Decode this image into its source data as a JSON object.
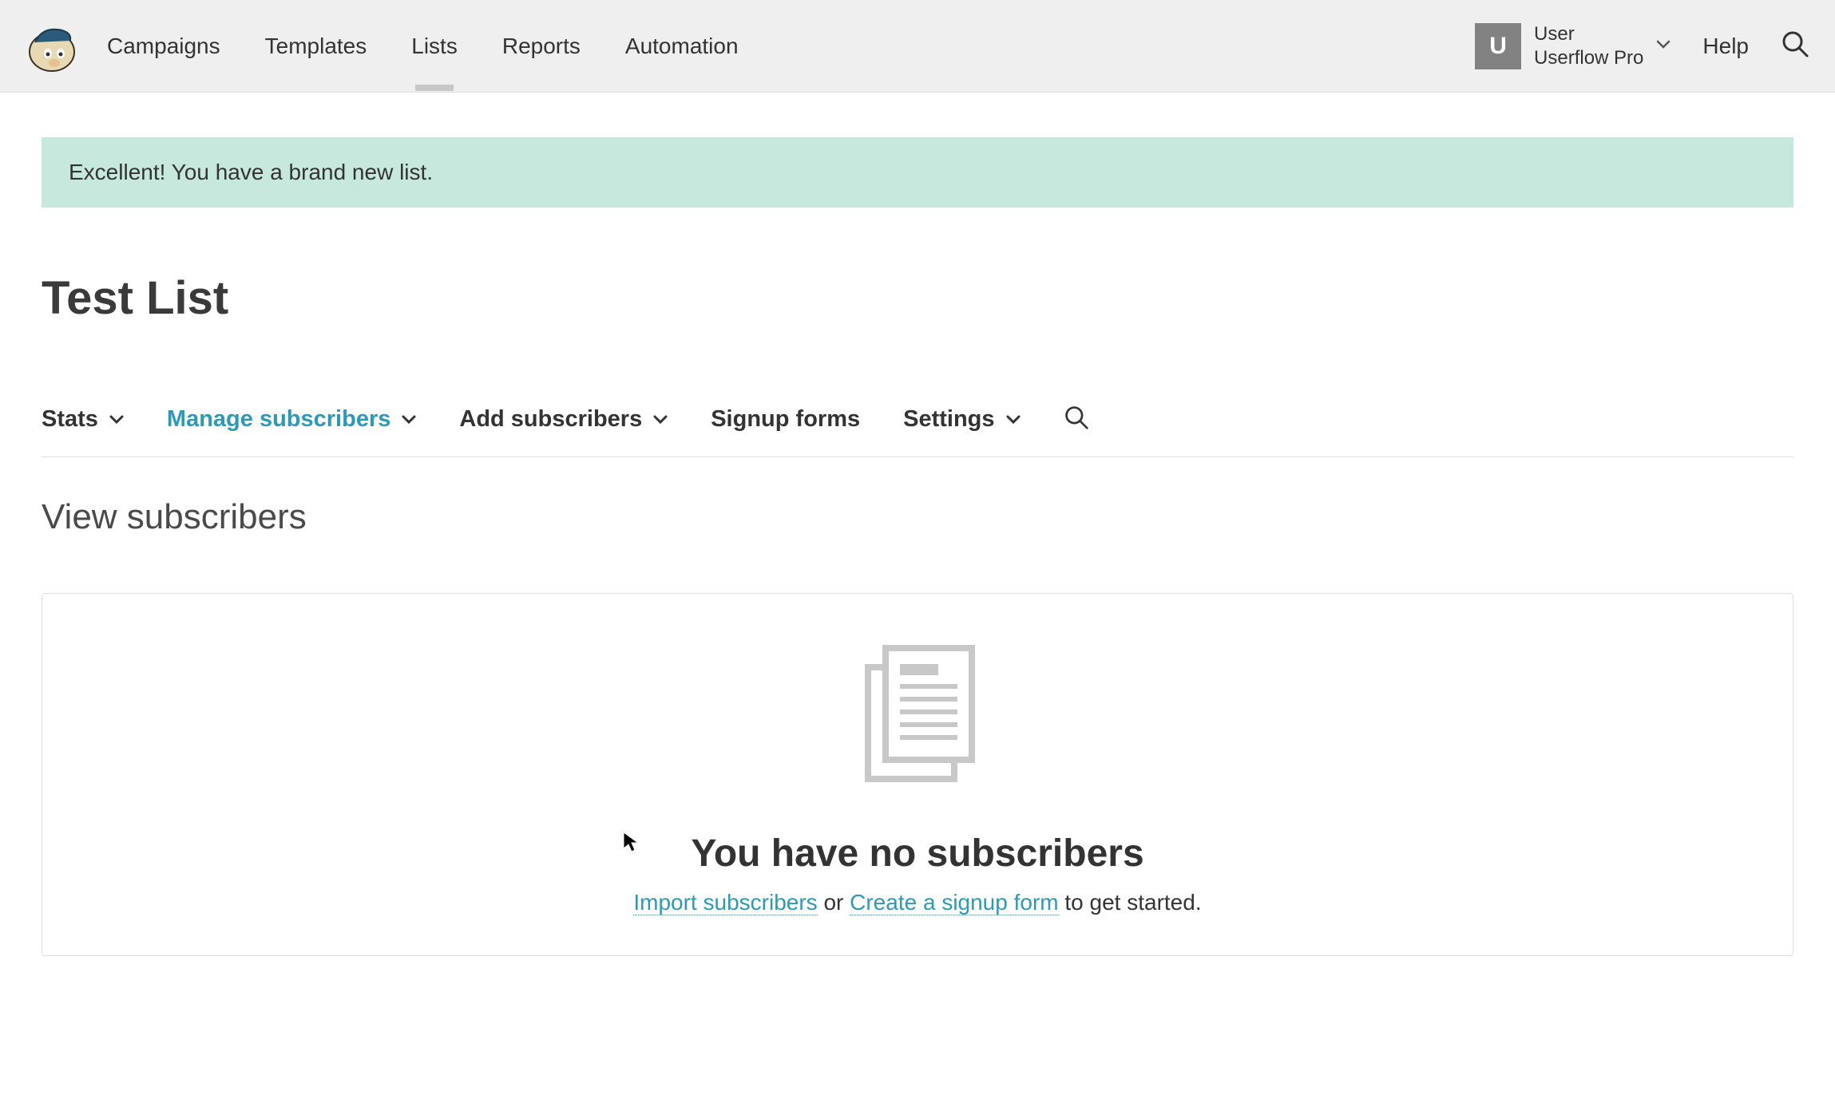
{
  "nav": {
    "items": [
      {
        "label": "Campaigns"
      },
      {
        "label": "Templates"
      },
      {
        "label": "Lists",
        "active": true
      },
      {
        "label": "Reports"
      },
      {
        "label": "Automation"
      }
    ],
    "help": "Help"
  },
  "user": {
    "avatar_letter": "U",
    "name": "User",
    "account": "Userflow Pro"
  },
  "notice": {
    "message": "Excellent! You have a brand new list."
  },
  "page": {
    "title": "Test List"
  },
  "subnav": {
    "items": [
      {
        "label": "Stats",
        "has_dropdown": true
      },
      {
        "label": "Manage subscribers",
        "has_dropdown": true,
        "active": true
      },
      {
        "label": "Add subscribers",
        "has_dropdown": true
      },
      {
        "label": "Signup forms",
        "has_dropdown": false
      },
      {
        "label": "Settings",
        "has_dropdown": true
      }
    ]
  },
  "section": {
    "title": "View subscribers"
  },
  "empty": {
    "title": "You have no subscribers",
    "link1": "Import subscribers",
    "connector": " or ",
    "link2": "Create a signup form",
    "suffix": " to get started."
  }
}
